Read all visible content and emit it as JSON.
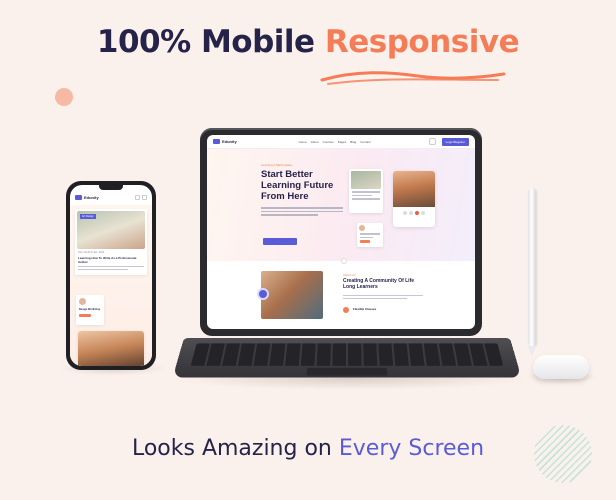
{
  "headline": {
    "part1": "100% Mobile",
    "part2": "Responsive"
  },
  "footer": {
    "part1": "Looks Amazing on",
    "part2": "Every Screen"
  },
  "colors": {
    "background": "#fbf1ec",
    "navy": "#26234a",
    "coral": "#f47c56",
    "indigo": "#5a5bd6"
  },
  "tablet_site": {
    "logo": "Edunity",
    "menu": [
      "Home",
      "About",
      "Courses",
      "Pages",
      "Blog",
      "Contact"
    ],
    "login_label": "Login/Register",
    "hero_eyebrow": "Learning A Skill Is Easy",
    "hero_title": "Start Better Learning Future From Here",
    "card_title": "Learning How To Write As A Professional Author",
    "about_eyebrow": "About Us",
    "about_title": "Creating A Community Of Life Long Learners",
    "about_feature": "Flexible Classes"
  },
  "phone_site": {
    "logo": "Edunity",
    "card_badge": "Art Design",
    "card_meta": "Jhon Smith   5 Jan, 2023",
    "card_title": "Learning How To Write As a Professional Author",
    "mini_title": "Design Workshop"
  }
}
